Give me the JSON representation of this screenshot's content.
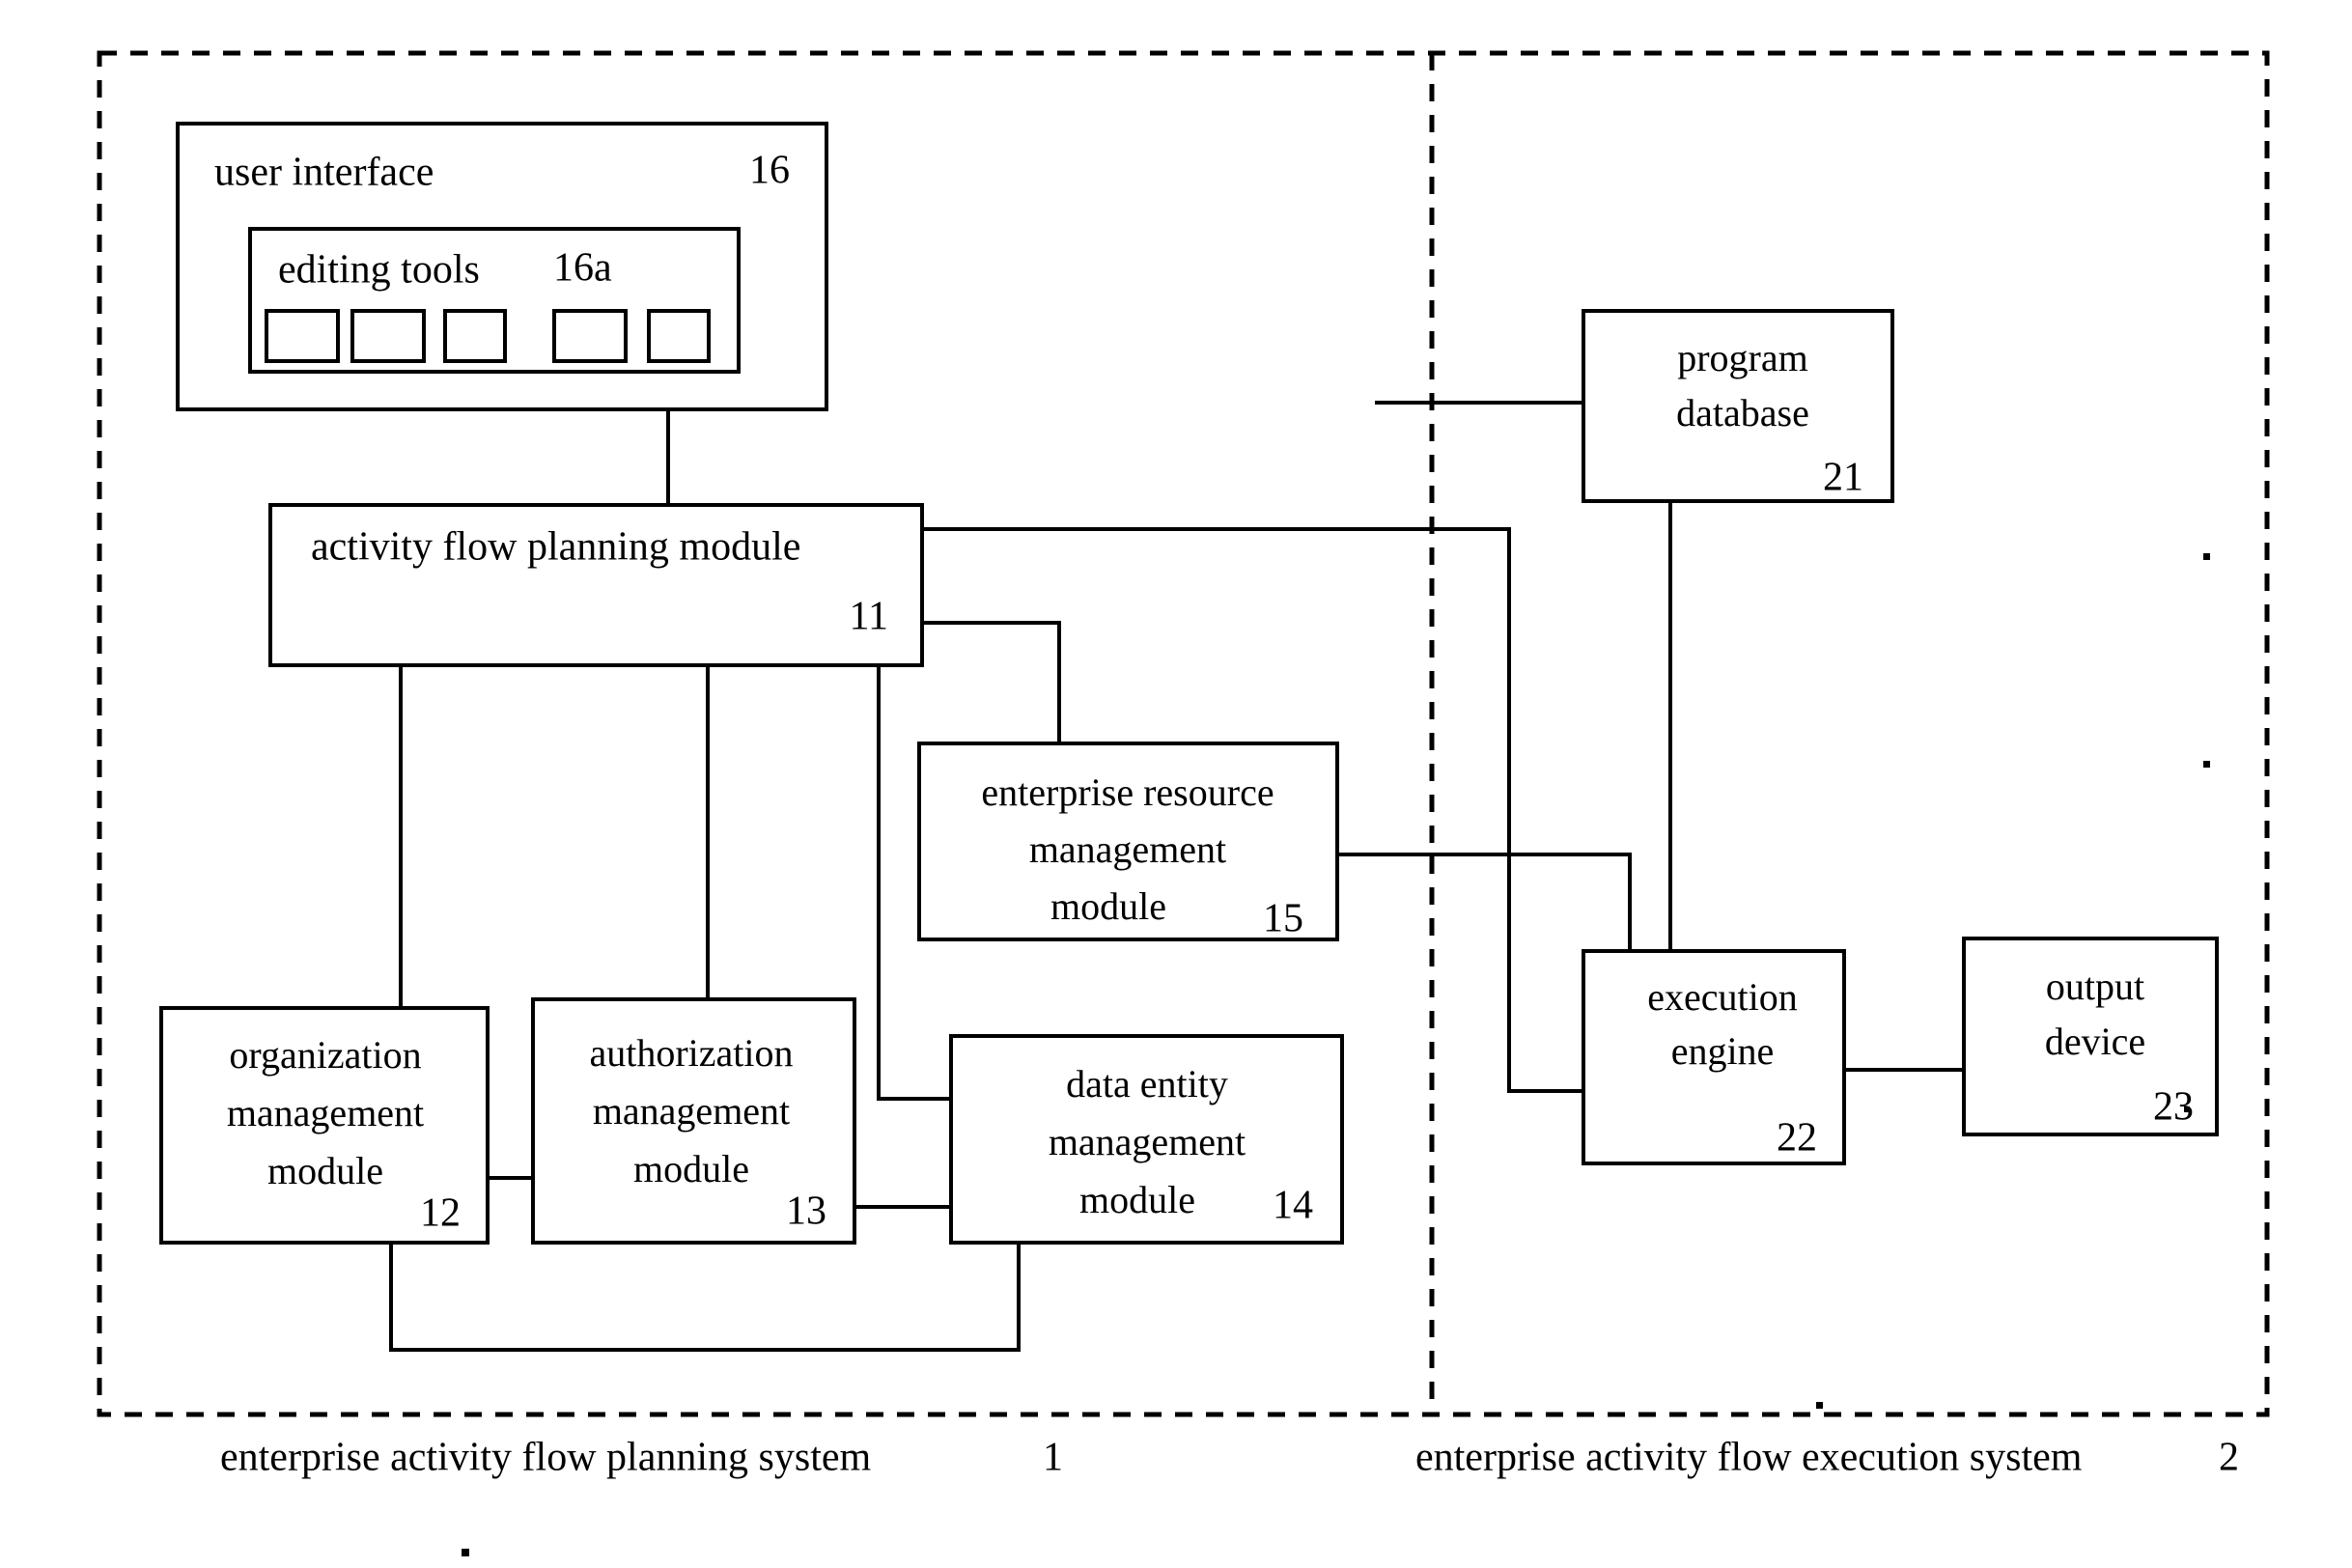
{
  "figure": {
    "type": "patent-block-diagram",
    "boxes": [
      {
        "id": "user-interface",
        "label": "user interface",
        "ref": "16"
      },
      {
        "id": "editing-tools",
        "label": "editing tools",
        "ref": "16a",
        "tool_count": 5
      },
      {
        "id": "activity-flow-planning-module",
        "label": "activity flow planning module",
        "ref": "11"
      },
      {
        "id": "enterprise-resource-management-module",
        "line1": "enterprise resource",
        "line2": "management",
        "line3": "module",
        "ref": "15"
      },
      {
        "id": "organization-management-module",
        "line1": "organization",
        "line2": "management",
        "line3": "module",
        "ref": "12"
      },
      {
        "id": "authorization-management-module",
        "line1": "authorization",
        "line2": "management",
        "line3": "module",
        "ref": "13"
      },
      {
        "id": "data-entity-management-module",
        "line1": "data entity",
        "line2": "management",
        "line3": "module",
        "ref": "14"
      },
      {
        "id": "program-database",
        "line1": "program",
        "line2": "database",
        "ref": "21"
      },
      {
        "id": "execution-engine",
        "line1": "execution",
        "line2": "engine",
        "ref": "22"
      },
      {
        "id": "output-device",
        "line1": "output",
        "line2": "device",
        "ref": "23"
      }
    ],
    "captions": [
      {
        "id": "planning-system-caption",
        "label": "enterprise activity flow planning system",
        "ref": "1"
      },
      {
        "id": "execution-system-caption",
        "label": "enterprise activity flow execution system",
        "ref": "2"
      }
    ],
    "colors": {
      "stroke": "#000000",
      "fill": "#ffffff",
      "background": "#ffffff"
    }
  }
}
